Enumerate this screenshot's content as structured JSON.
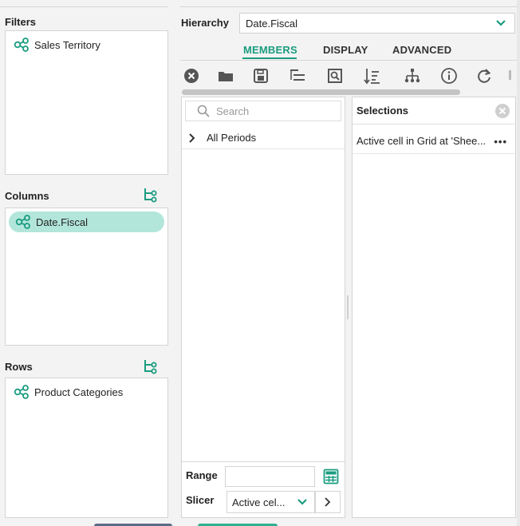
{
  "filters": {
    "title": "Filters",
    "items": [
      "Sales Territory"
    ]
  },
  "columns": {
    "title": "Columns",
    "items": [
      "Date.Fiscal"
    ]
  },
  "rows": {
    "title": "Rows",
    "items": [
      "Product Categories"
    ]
  },
  "hierarchy": {
    "label": "Hierarchy",
    "value": "Date.Fiscal"
  },
  "tabs": {
    "members": "MEMBERS",
    "display": "DISPLAY",
    "advanced": "ADVANCED"
  },
  "toolbar_icons": [
    "clear-icon",
    "folder-icon",
    "save-icon",
    "filter-list-icon",
    "search-doc-icon",
    "sort-icon",
    "hierarchy-icon",
    "info-icon",
    "refresh-icon"
  ],
  "members": {
    "search_placeholder": "Search",
    "tree": [
      {
        "label": "All Periods"
      }
    ],
    "range_label": "Range",
    "slicer_label": "Slicer",
    "slicer_value": "Active cel..."
  },
  "selections": {
    "title": "Selections",
    "items": [
      {
        "label": "Active cell in Grid at 'Shee..."
      }
    ]
  },
  "colors": {
    "accent": "#1a9c80",
    "pill": "#b3e6da"
  }
}
